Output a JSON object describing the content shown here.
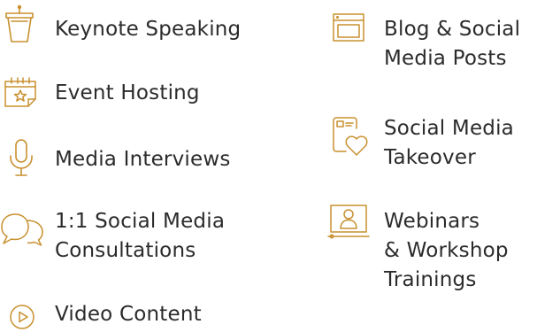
{
  "accent_color": "#C8902F",
  "text_color": "#2B2B2B",
  "left_column": [
    {
      "icon": "podium-icon",
      "lines": [
        "Keynote Speaking"
      ]
    },
    {
      "icon": "calendar-star-icon",
      "lines": [
        "Event Hosting"
      ]
    },
    {
      "icon": "microphone-icon",
      "lines": [
        "Media Interviews"
      ]
    },
    {
      "icon": "chat-bubbles-icon",
      "lines": [
        "1:1 Social Media",
        "Consultations"
      ]
    },
    {
      "icon": "play-circle-icon",
      "lines": [
        "Video Content"
      ]
    }
  ],
  "right_column": [
    {
      "icon": "browser-window-icon",
      "lines": [
        "Blog & Social",
        "Media Posts"
      ]
    },
    {
      "icon": "phone-heart-icon",
      "lines": [
        "Social Media",
        "Takeover"
      ]
    },
    {
      "icon": "laptop-user-icon",
      "lines": [
        "Webinars",
        "& Workshop",
        "Trainings"
      ]
    }
  ]
}
